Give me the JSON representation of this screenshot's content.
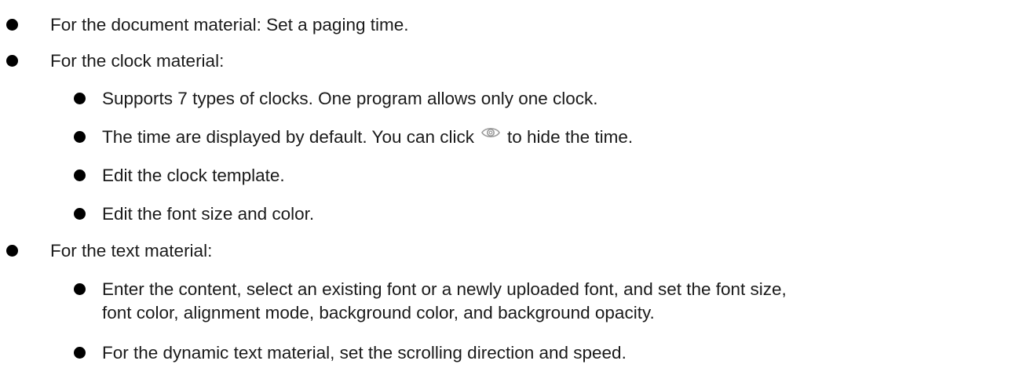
{
  "items": [
    {
      "level": 1,
      "text": "For the document material: Set a paging time."
    },
    {
      "level": 1,
      "text": "For the clock material:"
    },
    {
      "level": 2,
      "text": "Supports 7 types of clocks. One program allows only one clock."
    },
    {
      "level": 2,
      "text_before": "The time are displayed by default. You can click",
      "icon": "eye-icon",
      "text_after": "to hide the time."
    },
    {
      "level": 2,
      "text": "Edit the clock template."
    },
    {
      "level": 2,
      "text": "Edit the font size and color."
    },
    {
      "level": 1,
      "text": "For the text material:"
    },
    {
      "level": 2,
      "line1": "Enter the content, select an existing font or a newly uploaded font, and set the font size,",
      "line2": "font color, alignment mode, background color, and background opacity."
    },
    {
      "level": 2,
      "text": "For the dynamic text material, set the scrolling direction and speed."
    }
  ],
  "colors": {
    "text": "#1a1a1a",
    "bullet": "#000000",
    "icon": "#9a9a9a"
  }
}
